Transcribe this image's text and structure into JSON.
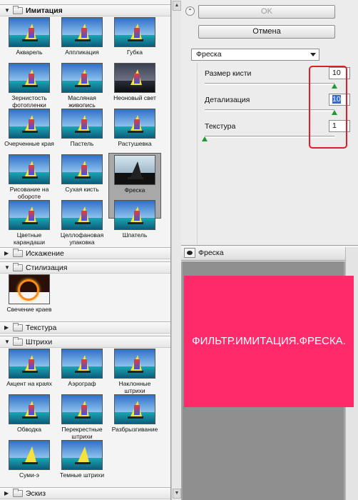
{
  "categories": {
    "imitation": {
      "label": "Имитация"
    },
    "distortion": {
      "label": "Искажение"
    },
    "stylize": {
      "label": "Стилизация"
    },
    "texture": {
      "label": "Текстура"
    },
    "strokes": {
      "label": "Штрихи"
    },
    "sketch": {
      "label": "Эскиз"
    }
  },
  "imitation_filters": [
    "Акварель",
    "Аппликация",
    "Губка",
    "Зернистость фотопленки",
    "Масляная живопись",
    "Неоновый свет",
    "Очерченные края",
    "Пастель",
    "Растушевка",
    "Рисование на обороте",
    "Сухая кисть",
    "Фреска",
    "Цветные карандаши",
    "Целлофановая упаковка",
    "Шпатель"
  ],
  "stylize_filters": [
    "Свечение краев"
  ],
  "strokes_filters": [
    "Акцент на краях",
    "Аэрограф",
    "Наклонные штрихи",
    "Обводка",
    "Перекрестные штрихи",
    "Разбрызгивание",
    "Суми-э",
    "Темные штрихи"
  ],
  "buttons": {
    "ok": "OK",
    "cancel": "Отмена"
  },
  "filter_select": {
    "value": "Фреска"
  },
  "params": {
    "brush_size": {
      "label": "Размер кисти",
      "value": "10",
      "slider": 1.0
    },
    "detail": {
      "label": "Детализация",
      "value": "10",
      "slider": 1.0
    },
    "texture": {
      "label": "Текстура",
      "value": "1",
      "slider": 0.0
    }
  },
  "preview": {
    "title": "Фреска",
    "caption": "ФИЛЬТР.ИМИТАЦИЯ.ФРЕСКА."
  },
  "icons": {
    "collapse": "double-chevron-up-icon",
    "eye": "eye-icon",
    "dropdown": "chevron-down-icon"
  },
  "colors": {
    "highlight": "#e01d25",
    "slider_knob": "#1b9b2e",
    "caption_bg": "#ff2a6a"
  }
}
